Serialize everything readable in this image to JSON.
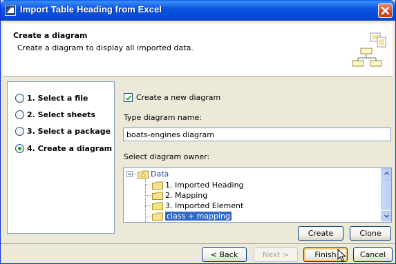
{
  "window": {
    "title": "Import Table Heading from Excel"
  },
  "header": {
    "title": "Create a diagram",
    "description": "Create a diagram to display all imported data."
  },
  "steps": [
    {
      "label": "1. Select a file",
      "selected": false
    },
    {
      "label": "2. Select sheets",
      "selected": false
    },
    {
      "label": "3. Select a package",
      "selected": false
    },
    {
      "label": "4. Create a diagram",
      "selected": true
    }
  ],
  "form": {
    "create_checkbox_label": "Create a new diagram",
    "create_checkbox_checked": true,
    "name_label": "Type diagram name:",
    "name_value": "boats-engines diagram",
    "owner_label": "Select diagram owner:"
  },
  "tree": {
    "root": "Data",
    "children": [
      {
        "label": "1. Imported Heading",
        "selected": false
      },
      {
        "label": "2. Mapping",
        "selected": false
      },
      {
        "label": "3. Imported Element",
        "selected": false
      },
      {
        "label": "class + mapping",
        "selected": true
      }
    ]
  },
  "buttons": {
    "create": "Create",
    "clone": "Clone",
    "back": "< Back",
    "next": "Next >",
    "finish": "Finish",
    "cancel": "Cancel"
  },
  "colors": {
    "titlebar": "#0a56e0",
    "selection": "#316ac5",
    "radio_dot": "#21a121"
  },
  "icons": {
    "title": "import-table-icon",
    "close": "close-icon",
    "header": "diagram-hierarchy-icon",
    "folder": "folder-icon"
  }
}
